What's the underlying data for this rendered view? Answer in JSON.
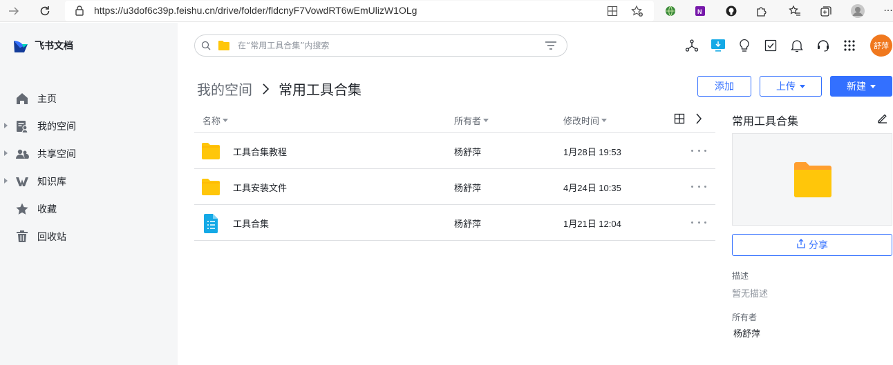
{
  "browser": {
    "url": "https://u3dof6c39p.feishu.cn/drive/folder/fldcnyF7VowdRT6wEmUlizW1OLg",
    "more_label": "···"
  },
  "app": {
    "logo_text": "飞书文档",
    "avatar_text": "舒萍",
    "brand_color": "#3370ff"
  },
  "sidebar": {
    "items": [
      {
        "label": "主页",
        "icon": "home-icon",
        "expandable": false
      },
      {
        "label": "我的空间",
        "icon": "my-space-icon",
        "expandable": true
      },
      {
        "label": "共享空间",
        "icon": "shared-space-icon",
        "expandable": true
      },
      {
        "label": "知识库",
        "icon": "wiki-icon",
        "expandable": true
      },
      {
        "label": "收藏",
        "icon": "star-icon",
        "expandable": false
      },
      {
        "label": "回收站",
        "icon": "trash-icon",
        "expandable": false
      }
    ]
  },
  "search": {
    "placeholder": "在“常用工具合集”内搜索"
  },
  "breadcrumb": {
    "parent": "我的空间",
    "current": "常用工具合集"
  },
  "actions": {
    "add": "添加",
    "upload": "上传",
    "create": "新建"
  },
  "table": {
    "columns": {
      "name": "名称",
      "owner": "所有者",
      "modified": "修改时间"
    },
    "rows": [
      {
        "name": "工具合集教程",
        "owner": "杨舒萍",
        "modified": "1月28日 19:53",
        "type": "folder"
      },
      {
        "name": "工具安装文件",
        "owner": "杨舒萍",
        "modified": "4月24日 10:35",
        "type": "folder"
      },
      {
        "name": "工具合集",
        "owner": "杨舒萍",
        "modified": "1月21日 12:04",
        "type": "doc"
      }
    ]
  },
  "panel": {
    "title": "常用工具合集",
    "share": "分享",
    "desc_label": "描述",
    "desc_value": "暂无描述",
    "owner_label": "所有者",
    "owner_value": "杨舒萍"
  }
}
